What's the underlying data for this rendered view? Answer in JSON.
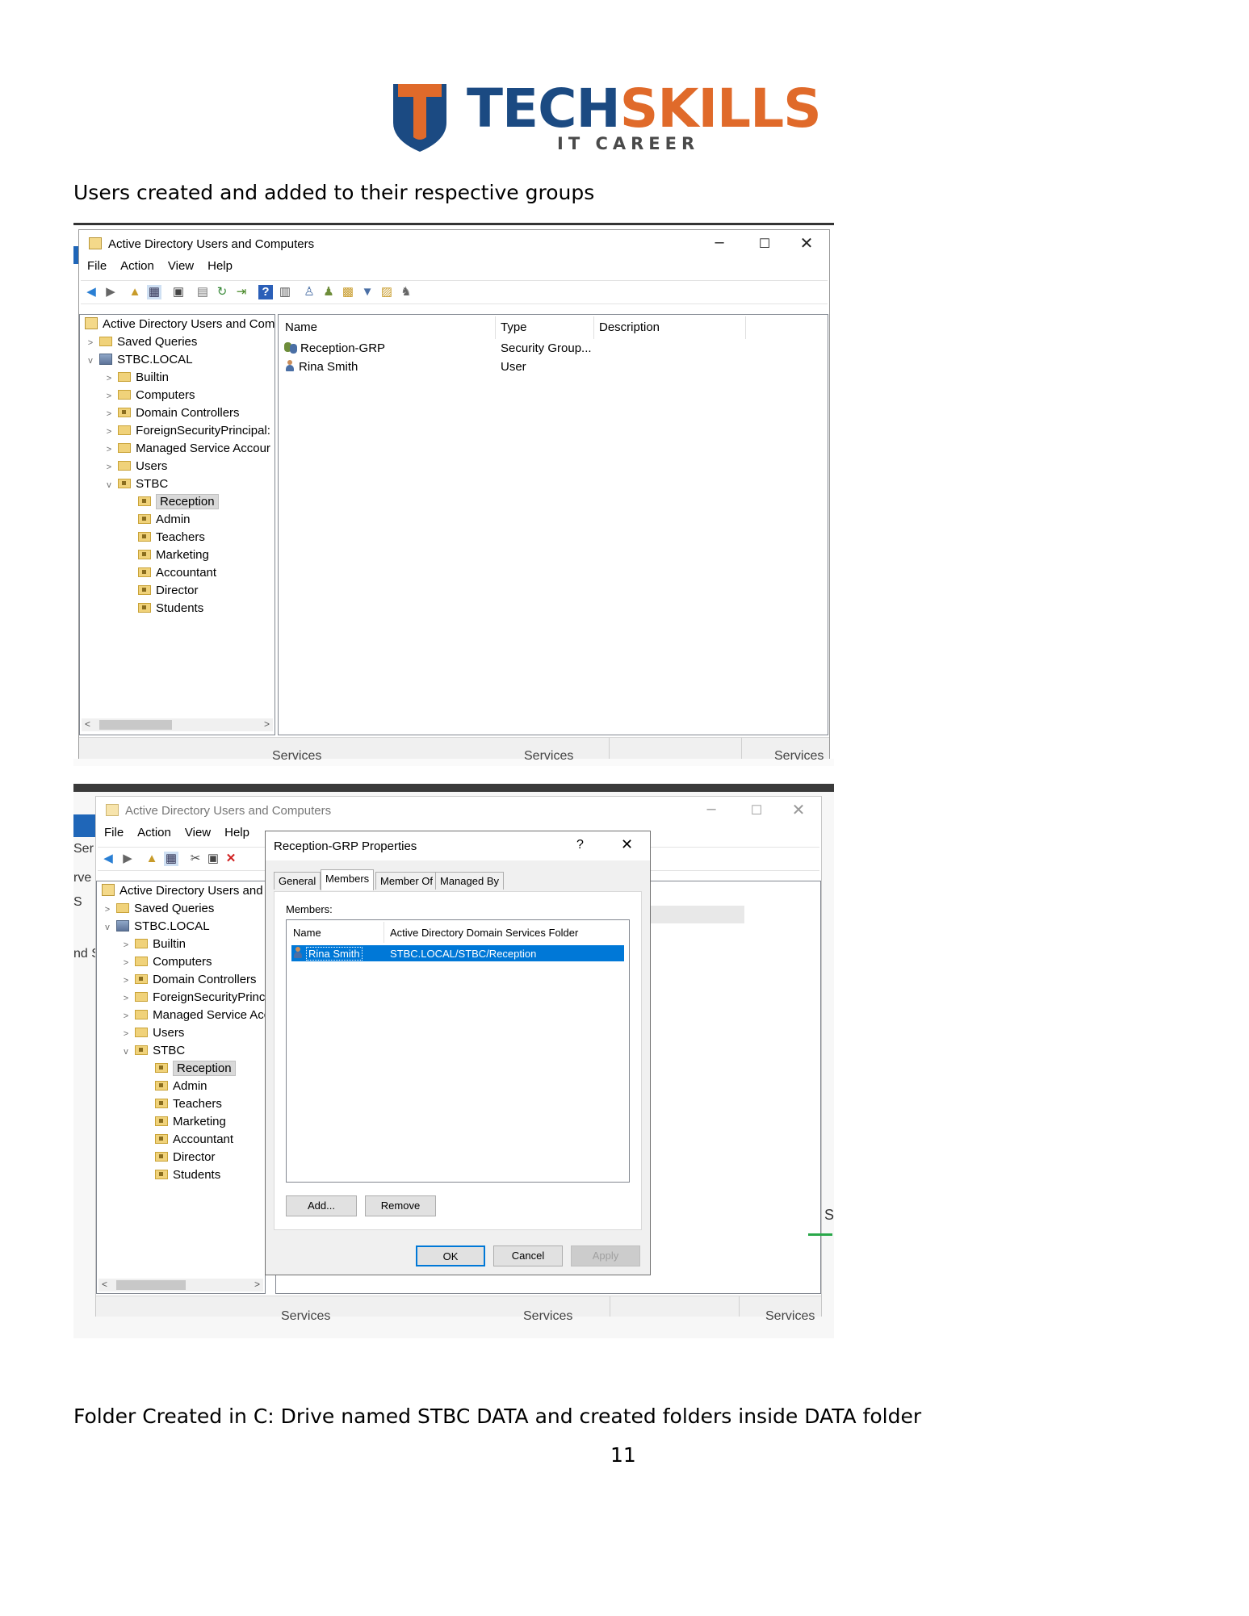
{
  "logo": {
    "word1": "TECH",
    "word2": "SKILLS",
    "tagline": "IT CAREER"
  },
  "paragraph_1": "Users created and added to their respective groups",
  "paragraph_2": "Folder Created in C: Drive named STBC DATA and created folders inside DATA folder",
  "page_number": "11",
  "screenshot_1": {
    "window_title": "Active Directory Users and Computers",
    "menu": [
      "File",
      "Action",
      "View",
      "Help"
    ],
    "tree": {
      "root": "Active Directory Users and Com",
      "saved_queries": "Saved Queries",
      "domain": "STBC.LOCAL",
      "containers": [
        "Builtin",
        "Computers",
        "Domain Controllers",
        "ForeignSecurityPrincipal:",
        "Managed Service Accour",
        "Users"
      ],
      "ou": "STBC",
      "children": [
        "Reception",
        "Admin",
        "Teachers",
        "Marketing",
        "Accountant",
        "Director",
        "Students"
      ]
    },
    "columns": {
      "name": "Name",
      "type": "Type",
      "description": "Description"
    },
    "rows": [
      {
        "name": "Reception-GRP",
        "type": "Security Group..."
      },
      {
        "name": "Rina Smith",
        "type": "User"
      }
    ],
    "background_labels": [
      "Services",
      "Services",
      "Services"
    ]
  },
  "screenshot_2": {
    "window_title": "Active Directory Users and Computers",
    "menu": [
      "File",
      "Action",
      "View",
      "Help"
    ],
    "tree": {
      "root": "Active Directory Users and C",
      "saved_queries": "Saved Queries",
      "domain": "STBC.LOCAL",
      "containers": [
        "Builtin",
        "Computers",
        "Domain Controllers",
        "ForeignSecurityPrinci",
        "Managed Service Acc",
        "Users"
      ],
      "ou": "STBC",
      "children": [
        "Reception",
        "Admin",
        "Teachers",
        "Marketing",
        "Accountant",
        "Director",
        "Students"
      ]
    },
    "dialog": {
      "title": "Reception-GRP Properties",
      "help": "?",
      "tabs": [
        "General",
        "Members",
        "Member Of",
        "Managed By"
      ],
      "members_label": "Members:",
      "col_name": "Name",
      "col_folder": "Active Directory Domain Services Folder",
      "member_name": "Rina Smith",
      "member_folder": "STBC.LOCAL/STBC/Reception",
      "add": "Add...",
      "remove": "Remove",
      "ok": "OK",
      "cancel": "Cancel",
      "apply": "Apply"
    },
    "background_labels": [
      "Services",
      "Services",
      "Services"
    ]
  }
}
